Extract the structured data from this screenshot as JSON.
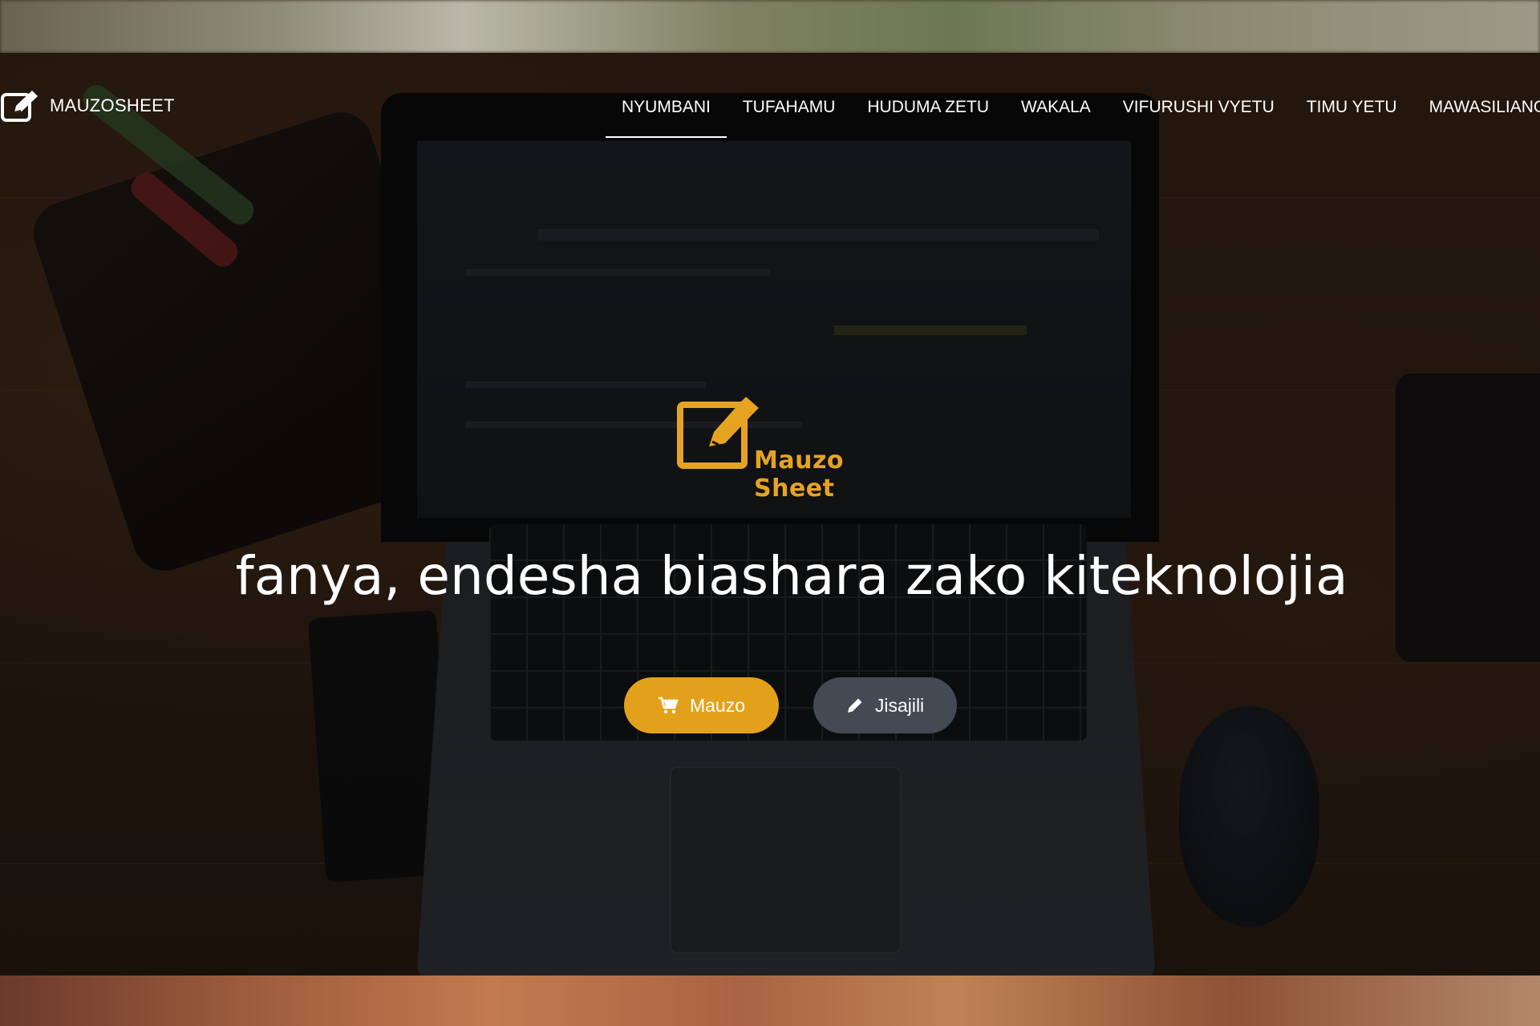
{
  "brand": {
    "icon": "edit-square-icon",
    "name": "MAUZOSHEET"
  },
  "nav": {
    "items": [
      {
        "label": "NYUMBANI",
        "active": true
      },
      {
        "label": "TUFAHAMU",
        "active": false
      },
      {
        "label": "HUDUMA ZETU",
        "active": false
      },
      {
        "label": "WAKALA",
        "active": false
      },
      {
        "label": "VIFURUSHI VYETU",
        "active": false
      },
      {
        "label": "TIMU YETU",
        "active": false
      },
      {
        "label": "MAWASILIANO",
        "active": false
      }
    ]
  },
  "hero": {
    "logo_icon": "edit-pencil-icon",
    "logo_text": "Mauzo Sheet",
    "headline": "fanya, endesha biashara zako kiteknolojia",
    "primary_button": {
      "label": "Mauzo",
      "icon": "cart-icon"
    },
    "secondary_button": {
      "label": "Jisajili",
      "icon": "pencil-icon"
    }
  },
  "colors": {
    "accent": "#e3a11b",
    "secondary_button": "#434a53",
    "nav_text": "#ffffff"
  }
}
